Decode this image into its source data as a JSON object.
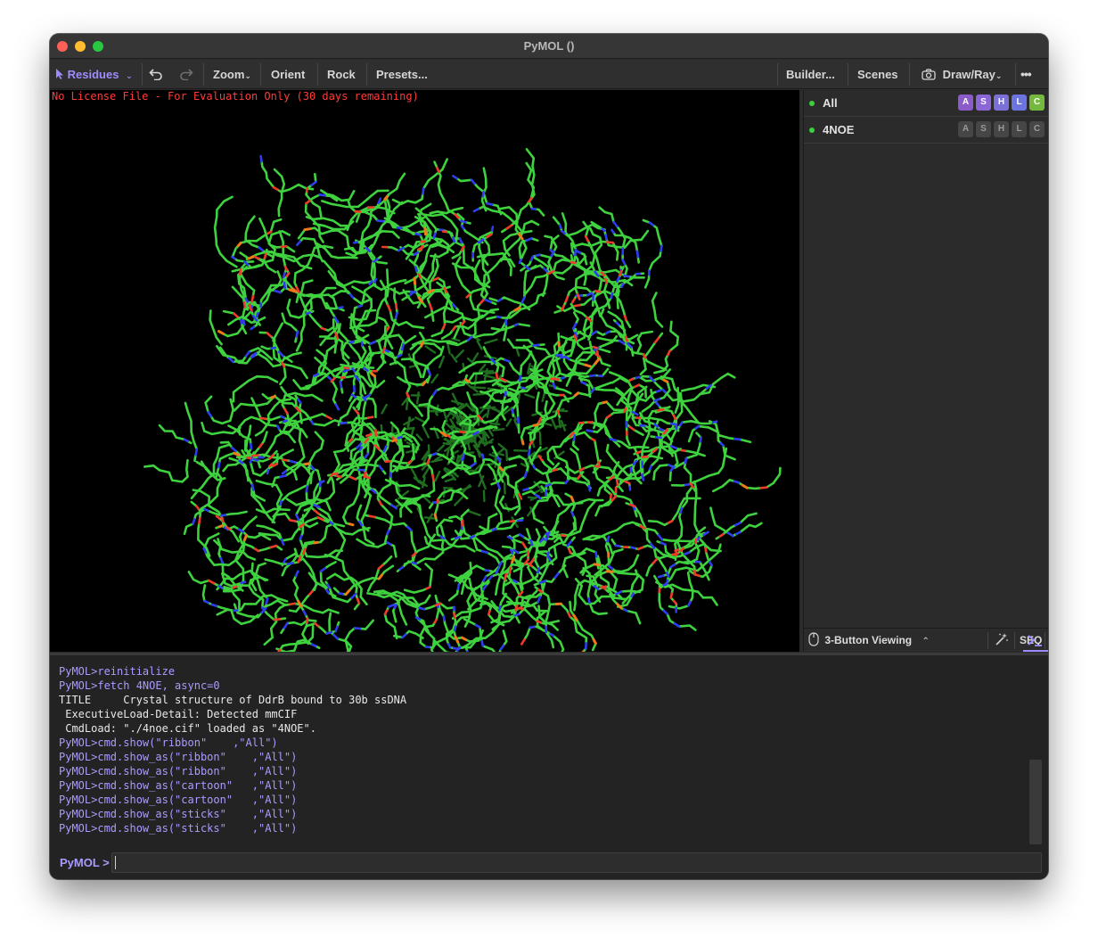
{
  "window": {
    "title": "PyMOL ()"
  },
  "toolbar": {
    "selection_mode": "Residues",
    "zoom_label": "Zoom",
    "orient_label": "Orient",
    "rock_label": "Rock",
    "presets_label": "Presets...",
    "builder_label": "Builder...",
    "scenes_label": "Scenes",
    "drawray_label": "Draw/Ray",
    "more_label": "•••"
  },
  "viewport": {
    "license_text": "No License File - For Evaluation Only (30 days remaining)",
    "colors": {
      "carbon": "#3fd23f",
      "nitrogen": "#2f3cf0",
      "oxygen": "#f03a2a",
      "phosphorus": "#f07a1a"
    }
  },
  "objects": [
    {
      "name": "All",
      "buttons": [
        "A",
        "S",
        "H",
        "L",
        "C"
      ]
    },
    {
      "name": "4NOE",
      "buttons": [
        "A",
        "S",
        "H",
        "L",
        "C"
      ]
    }
  ],
  "mouse_bar": {
    "mode_label": "3-Button Viewing",
    "seq_label": "SEQ"
  },
  "console": {
    "lines": [
      {
        "text": "PyMOL>reinitialize",
        "kind": "cmd"
      },
      {
        "text": "PyMOL>fetch 4NOE, async=0",
        "kind": "cmd"
      },
      {
        "text": "TITLE     Crystal structure of DdrB bound to 30b ssDNA",
        "kind": "out"
      },
      {
        "text": " ExecutiveLoad-Detail: Detected mmCIF",
        "kind": "out"
      },
      {
        "text": " CmdLoad: \"./4noe.cif\" loaded as \"4NOE\".",
        "kind": "out"
      },
      {
        "text": "PyMOL>cmd.show(\"ribbon\"    ,\"All\")",
        "kind": "cmd"
      },
      {
        "text": "PyMOL>cmd.show_as(\"ribbon\"    ,\"All\")",
        "kind": "cmd"
      },
      {
        "text": "PyMOL>cmd.show_as(\"ribbon\"    ,\"All\")",
        "kind": "cmd"
      },
      {
        "text": "PyMOL>cmd.show_as(\"cartoon\"   ,\"All\")",
        "kind": "cmd"
      },
      {
        "text": "PyMOL>cmd.show_as(\"cartoon\"   ,\"All\")",
        "kind": "cmd"
      },
      {
        "text": "PyMOL>cmd.show_as(\"sticks\"    ,\"All\")",
        "kind": "cmd"
      },
      {
        "text": "PyMOL>cmd.show_as(\"sticks\"    ,\"All\")",
        "kind": "cmd"
      }
    ],
    "prompt_label": "PyMOL >",
    "input_value": ""
  }
}
